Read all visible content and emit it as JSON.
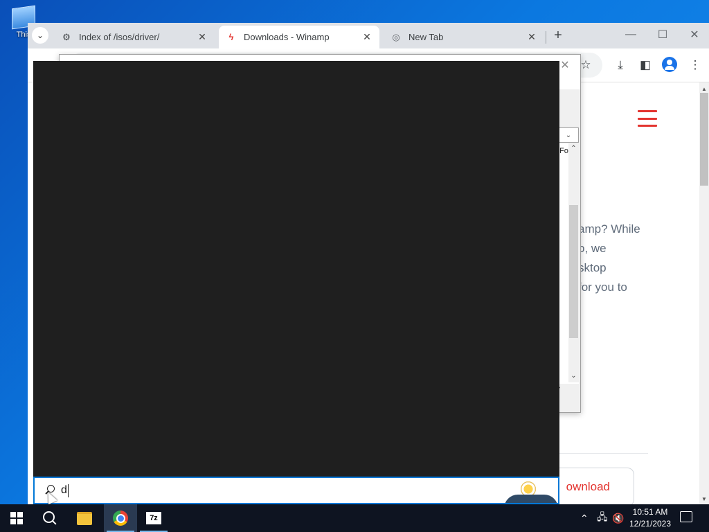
{
  "desktop": {
    "icon_label": "This"
  },
  "browser": {
    "tabs": [
      {
        "label": "Index of /isos/driver/",
        "icon": "page-icon",
        "active": false
      },
      {
        "label": "Downloads - Winamp",
        "icon": "winamp-icon",
        "active": true
      },
      {
        "label": "New Tab",
        "icon": "chrome-icon",
        "active": false
      }
    ],
    "new_tab_symbol": "+",
    "close_symbol": "✕"
  },
  "page": {
    "text_lines": [
      "amp? While",
      "o, we",
      "sktop",
      "for you to"
    ],
    "download_button": "ownload",
    "accent_color": "#e3342f"
  },
  "file_dialog": {
    "column_header": "Fol"
  },
  "search": {
    "query": "d"
  },
  "taskbar": {
    "time": "10:51 AM",
    "date": "12/21/2023",
    "apps": [
      "start-icon",
      "search-icon",
      "file-explorer-icon",
      "chrome-icon",
      "7zip-icon"
    ],
    "sevenzip_label": "7z"
  }
}
